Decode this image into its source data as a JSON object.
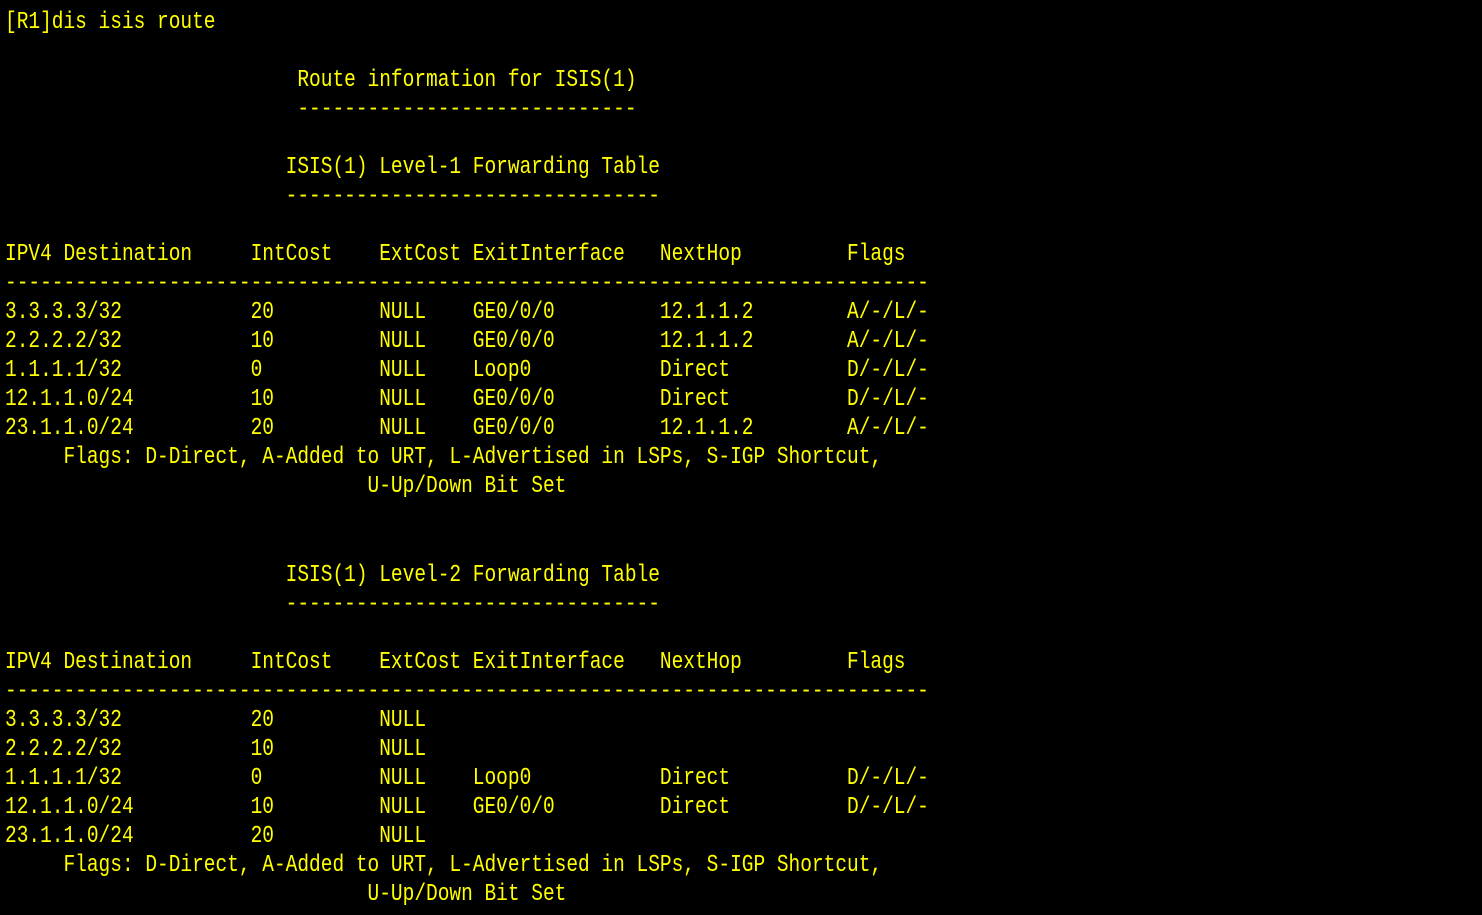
{
  "terminal": {
    "text_color": "#ffff00",
    "background_color": "#000000"
  },
  "lines": [
    "[R1]dis isis route",
    "",
    "                         Route information for ISIS(1)",
    "                         -----------------------------",
    "",
    "                        ISIS(1) Level-1 Forwarding Table",
    "                        --------------------------------",
    "",
    "IPV4 Destination     IntCost    ExtCost ExitInterface   NextHop         Flags",
    "-------------------------------------------------------------------------------",
    "3.3.3.3/32           20         NULL    GE0/0/0         12.1.1.2        A/-/L/-",
    "2.2.2.2/32           10         NULL    GE0/0/0         12.1.1.2        A/-/L/-",
    "1.1.1.1/32           0          NULL    Loop0           Direct          D/-/L/-",
    "12.1.1.0/24          10         NULL    GE0/0/0         Direct          D/-/L/-",
    "23.1.1.0/24          20         NULL    GE0/0/0         12.1.1.2        A/-/L/-",
    "     Flags: D-Direct, A-Added to URT, L-Advertised in LSPs, S-IGP Shortcut,",
    "                               U-Up/Down Bit Set",
    "",
    "",
    "                        ISIS(1) Level-2 Forwarding Table",
    "                        --------------------------------",
    "",
    "IPV4 Destination     IntCost    ExtCost ExitInterface   NextHop         Flags",
    "-------------------------------------------------------------------------------",
    "3.3.3.3/32           20         NULL",
    "2.2.2.2/32           10         NULL",
    "1.1.1.1/32           0          NULL    Loop0           Direct          D/-/L/-",
    "12.1.1.0/24          10         NULL    GE0/0/0         Direct          D/-/L/-",
    "23.1.1.0/24          20         NULL",
    "     Flags: D-Direct, A-Added to URT, L-Advertised in LSPs, S-IGP Shortcut,",
    "                               U-Up/Down Bit Set"
  ]
}
